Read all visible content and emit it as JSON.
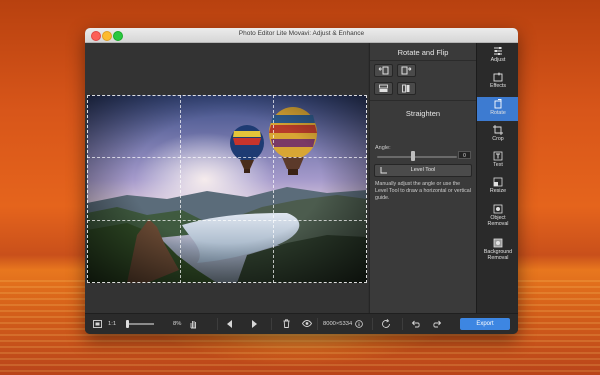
{
  "window": {
    "title": "Photo Editor Lite Movavi: Adjust & Enhance"
  },
  "panel": {
    "rotate_flip_heading": "Rotate and Flip",
    "straighten_heading": "Straighten",
    "angle_label": "Angle:",
    "angle_value": "0",
    "level_tool_label": "Level Tool",
    "help_text": "Manually adjust the angle or use the Level Tool to draw a horizontal or vertical guide."
  },
  "sidebar": {
    "items": [
      {
        "label": "Adjust",
        "icon": "sliders-icon",
        "active": false
      },
      {
        "label": "Effects",
        "icon": "effects-icon",
        "active": false
      },
      {
        "label": "Rotate",
        "icon": "rotate-icon",
        "active": true
      },
      {
        "label": "Crop",
        "icon": "crop-icon",
        "active": false
      },
      {
        "label": "Text",
        "icon": "text-icon",
        "active": false
      },
      {
        "label": "Resize",
        "icon": "resize-icon",
        "active": false
      },
      {
        "label": "Object Removal",
        "label_line1": "Object",
        "label_line2": "Removal",
        "icon": "object-removal-icon",
        "active": false
      },
      {
        "label": "Background Removal",
        "label_line1": "Background",
        "label_line2": "Removal",
        "icon": "background-removal-icon",
        "active": false
      }
    ]
  },
  "bottombar": {
    "zoom_ratio": "1:1",
    "zoom_percent": "8%",
    "image_size": "8000×5334",
    "export_label": "Export"
  },
  "colors": {
    "accent": "#3d7bd1",
    "export": "#3d86e2",
    "panel_bg": "#3a3a3a",
    "window_bg": "#2f2f2f"
  }
}
